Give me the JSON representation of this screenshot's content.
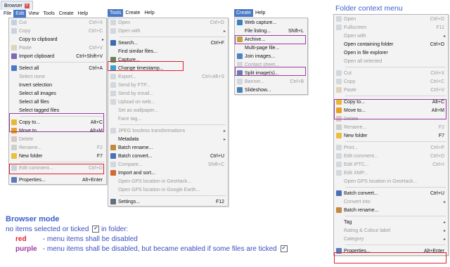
{
  "tab": {
    "title": "Browser",
    "close_glyph": "×"
  },
  "menubar": [
    {
      "label": "File"
    },
    {
      "label": "Edit"
    },
    {
      "label": "View"
    },
    {
      "label": "Tools"
    },
    {
      "label": "Create"
    },
    {
      "label": "Help"
    }
  ],
  "menubar_tools": [
    {
      "label": "Tools"
    },
    {
      "label": "Create"
    },
    {
      "label": "Help"
    }
  ],
  "menubar_create": [
    {
      "label": "Create"
    },
    {
      "label": "Help"
    }
  ],
  "edit_menu": [
    {
      "label": "Cut",
      "shortcut": "Ctrl+X",
      "disabled": true,
      "icon": "cut-icon",
      "color": "#9bb4d6"
    },
    {
      "label": "Copy",
      "shortcut": "Ctrl+C",
      "disabled": true,
      "icon": "copy-icon",
      "color": "#a9b8cc"
    },
    {
      "label": "Copy to clipboard",
      "shortcut": "",
      "disabled": false,
      "submenu": true
    },
    {
      "label": "Paste",
      "shortcut": "Ctrl+V",
      "disabled": true,
      "icon": "paste-icon",
      "color": "#c9b98a"
    },
    {
      "label": "Import clipboard",
      "shortcut": "Ctrl+Shift+V",
      "disabled": false,
      "icon": "import-clipboard-icon",
      "color": "#7b6bb0"
    },
    {
      "sep": true
    },
    {
      "label": "Select all",
      "shortcut": "Ctrl+A",
      "disabled": false,
      "icon": "select-all-icon",
      "color": "#4a78c8"
    },
    {
      "label": "Select none",
      "shortcut": "",
      "disabled": true
    },
    {
      "label": "Invert selection",
      "shortcut": "",
      "disabled": false
    },
    {
      "label": "Select all images",
      "shortcut": "",
      "disabled": false
    },
    {
      "label": "Select all files",
      "shortcut": "",
      "disabled": false
    },
    {
      "label": "Select tagged files",
      "shortcut": "",
      "disabled": false
    },
    {
      "sep": true
    },
    {
      "label": "Copy to...",
      "shortcut": "Alt+C",
      "disabled": false,
      "icon": "copy-to-folder-icon",
      "color": "#e8b830"
    },
    {
      "label": "Move to...",
      "shortcut": "Alt+M",
      "disabled": false,
      "icon": "move-to-folder-icon",
      "color": "#e8a020"
    },
    {
      "label": "Delete",
      "shortcut": "",
      "disabled": true,
      "icon": "delete-icon",
      "color": "#c9a0a0"
    },
    {
      "label": "Rename...",
      "shortcut": "F2",
      "disabled": true,
      "icon": "rename-icon",
      "color": "#b0b0b0"
    },
    {
      "label": "New folder",
      "shortcut": "F7",
      "disabled": false,
      "icon": "new-folder-icon",
      "color": "#e8c040"
    },
    {
      "sep": true
    },
    {
      "label": "Edit comment...",
      "shortcut": "Ctrl+D",
      "disabled": true,
      "icon": "comment-icon",
      "color": "#a8b8c8"
    },
    {
      "sep": true
    },
    {
      "label": "Properties...",
      "shortcut": "Alt+Enter",
      "disabled": false,
      "icon": "properties-icon",
      "color": "#5a7ab8"
    }
  ],
  "tools_menu": [
    {
      "label": "Open",
      "shortcut": "Ctrl+O",
      "disabled": true,
      "icon": "open-icon",
      "color": "#b8c0cc"
    },
    {
      "label": "Open with",
      "shortcut": "",
      "disabled": true,
      "submenu": true,
      "icon": "open-with-icon",
      "color": "#b8c0cc"
    },
    {
      "sep": true
    },
    {
      "label": "Search...",
      "shortcut": "Ctrl+F",
      "disabled": false,
      "icon": "search-icon",
      "color": "#3a6ab0"
    },
    {
      "label": "Find similar files...",
      "shortcut": "",
      "disabled": false
    },
    {
      "label": "Capture...",
      "shortcut": "",
      "disabled": false,
      "icon": "capture-icon",
      "color": "#5a8a5a"
    },
    {
      "label": "Change timestamp...",
      "shortcut": "",
      "disabled": false,
      "icon": "timestamp-icon",
      "color": "#3aa0d0"
    },
    {
      "label": "Export...",
      "shortcut": "Ctrl+Alt+S",
      "disabled": true,
      "icon": "export-icon",
      "color": "#b8c0cc"
    },
    {
      "label": "Send by FTP...",
      "shortcut": "",
      "disabled": true,
      "icon": "ftp-icon",
      "color": "#b8c0cc"
    },
    {
      "label": "Send by email...",
      "shortcut": "",
      "disabled": true,
      "icon": "email-icon",
      "color": "#b8c0cc"
    },
    {
      "label": "Upload on web...",
      "shortcut": "",
      "disabled": true,
      "icon": "web-upload-icon",
      "color": "#b8c0cc"
    },
    {
      "label": "Set as wallpaper...",
      "shortcut": "",
      "disabled": true
    },
    {
      "label": "Face tag...",
      "shortcut": "",
      "disabled": true
    },
    {
      "sep": true
    },
    {
      "label": "JPEG lossless transformations",
      "shortcut": "",
      "disabled": true,
      "submenu": true,
      "icon": "jpeg-icon",
      "color": "#b8c0cc"
    },
    {
      "label": "Metadata",
      "shortcut": "",
      "disabled": false,
      "submenu": true
    },
    {
      "label": "Batch rename...",
      "shortcut": "",
      "disabled": false,
      "icon": "batch-rename-icon",
      "color": "#c08a40"
    },
    {
      "label": "Batch convert...",
      "shortcut": "Ctrl+U",
      "disabled": false,
      "icon": "batch-convert-icon",
      "color": "#4a70b8"
    },
    {
      "label": "Compare...",
      "shortcut": "Shift+C",
      "disabled": true,
      "icon": "compare-icon",
      "color": "#b8c0cc"
    },
    {
      "label": "Import and sort...",
      "shortcut": "",
      "disabled": false,
      "icon": "import-sort-icon",
      "color": "#d06a30"
    },
    {
      "label": "Open GPS location in GeoHack...",
      "shortcut": "",
      "disabled": true
    },
    {
      "label": "Open GPS location in Google Earth...",
      "shortcut": "",
      "disabled": true
    },
    {
      "sep": true
    },
    {
      "label": "Settings...",
      "shortcut": "F12",
      "disabled": false,
      "icon": "settings-icon",
      "color": "#607080"
    }
  ],
  "create_menu": [
    {
      "label": "Web capture...",
      "shortcut": "",
      "disabled": false,
      "icon": "web-capture-icon",
      "color": "#3a80c0"
    },
    {
      "label": "File listing...",
      "shortcut": "Shift+L",
      "disabled": false
    },
    {
      "label": "Archive...",
      "shortcut": "",
      "disabled": false,
      "icon": "archive-icon",
      "color": "#c0a040"
    },
    {
      "label": "Multi-page file...",
      "shortcut": "",
      "disabled": false
    },
    {
      "label": "Join images...",
      "shortcut": "",
      "disabled": false,
      "icon": "join-images-icon",
      "color": "#5080c0"
    },
    {
      "label": "Contact sheet...",
      "shortcut": "",
      "disabled": true,
      "icon": "contact-sheet-icon",
      "color": "#b8c0cc"
    },
    {
      "label": "Split image(s)...",
      "shortcut": "",
      "disabled": false,
      "icon": "split-image-icon",
      "color": "#6a7ab0"
    },
    {
      "label": "Banner...",
      "shortcut": "Ctrl+B",
      "disabled": true,
      "icon": "banner-icon",
      "color": "#b8c0cc"
    },
    {
      "label": "Slideshow...",
      "shortcut": "",
      "disabled": false,
      "icon": "slideshow-icon",
      "color": "#4a80b0"
    }
  ],
  "context": {
    "title": "Folder context menu",
    "items": [
      {
        "label": "Open",
        "shortcut": "Ctrl+O",
        "disabled": true,
        "icon": "open-icon",
        "color": "#b8c0cc"
      },
      {
        "label": "Fullscreen",
        "shortcut": "F11",
        "disabled": true,
        "icon": "fullscreen-icon",
        "color": "#b8c0cc"
      },
      {
        "label": "Open with",
        "shortcut": "",
        "disabled": true,
        "submenu": true
      },
      {
        "label": "Open containing folder",
        "shortcut": "Ctrl+O",
        "disabled": false
      },
      {
        "label": "Open in file explorer",
        "shortcut": "",
        "disabled": false
      },
      {
        "label": "Open all selected",
        "shortcut": "",
        "disabled": true
      },
      {
        "sep": true
      },
      {
        "label": "Cut",
        "shortcut": "Ctrl+X",
        "disabled": true,
        "icon": "cut-icon",
        "color": "#b8c0cc"
      },
      {
        "label": "Copy",
        "shortcut": "Ctrl+C",
        "disabled": true,
        "icon": "copy-icon",
        "color": "#b8c0cc"
      },
      {
        "label": "Paste",
        "shortcut": "Ctrl+V",
        "disabled": true,
        "icon": "paste-icon",
        "color": "#c9b98a"
      },
      {
        "sep": true
      },
      {
        "label": "Copy to...",
        "shortcut": "Alt+C",
        "disabled": false,
        "icon": "copy-to-folder-icon",
        "color": "#e8b830"
      },
      {
        "label": "Move to...",
        "shortcut": "Alt+M",
        "disabled": false,
        "icon": "move-to-folder-icon",
        "color": "#e8a020"
      },
      {
        "label": "Delete",
        "shortcut": "",
        "disabled": true,
        "icon": "delete-icon",
        "color": "#c9a0a0"
      },
      {
        "label": "Rename...",
        "shortcut": "F2",
        "disabled": true,
        "icon": "rename-icon",
        "color": "#b0b0b0"
      },
      {
        "label": "New folder",
        "shortcut": "F7",
        "disabled": false,
        "icon": "new-folder-icon",
        "color": "#e8c040"
      },
      {
        "sep": true
      },
      {
        "label": "Print...",
        "shortcut": "Ctrl+P",
        "disabled": true,
        "icon": "print-icon",
        "color": "#b8c0cc"
      },
      {
        "label": "Edit comment...",
        "shortcut": "Ctrl+D",
        "disabled": true,
        "icon": "comment-icon",
        "color": "#b8c0cc"
      },
      {
        "label": "Edit IPTC...",
        "shortcut": "Ctrl+I",
        "disabled": true,
        "icon": "iptc-icon",
        "color": "#b8c0cc"
      },
      {
        "label": "Edit XMP...",
        "shortcut": "",
        "disabled": true,
        "icon": "xmp-icon",
        "color": "#b8c0cc"
      },
      {
        "label": "Open GPS location in GeoHack...",
        "shortcut": "",
        "disabled": true
      },
      {
        "sep": true
      },
      {
        "label": "Batch convert...",
        "shortcut": "Ctrl+U",
        "disabled": false,
        "icon": "batch-convert-icon",
        "color": "#4a70b8"
      },
      {
        "label": "Convert into",
        "shortcut": "",
        "disabled": true,
        "submenu": true
      },
      {
        "label": "Batch rename...",
        "shortcut": "",
        "disabled": false,
        "icon": "batch-rename-icon",
        "color": "#c08a40"
      },
      {
        "sep": true
      },
      {
        "label": "Tag",
        "shortcut": "",
        "disabled": false,
        "submenu": true
      },
      {
        "label": "Rating & Colour label",
        "shortcut": "",
        "disabled": true,
        "submenu": true
      },
      {
        "label": "Category",
        "shortcut": "",
        "disabled": true,
        "submenu": true
      },
      {
        "sep": true
      },
      {
        "label": "Properties...",
        "shortcut": "Alt+Enter",
        "disabled": false,
        "icon": "properties-icon",
        "color": "#5a7ab8"
      }
    ]
  },
  "legend": {
    "heading": "Browser mode",
    "line1": "no items selected or ticked",
    "line1_suffix": "in folder:",
    "red_word": "red",
    "red_desc": "- menu items shall be disabled",
    "purple_word": "purple",
    "purple_desc": "- menu items shall be disabled, but became enabled if some files are ticked",
    "check_glyph": "✔",
    "colors": {
      "heading": "#3a5fcd",
      "red": "#e0202e",
      "purple": "#9b3aa6",
      "text": "#3a4fc0"
    }
  }
}
